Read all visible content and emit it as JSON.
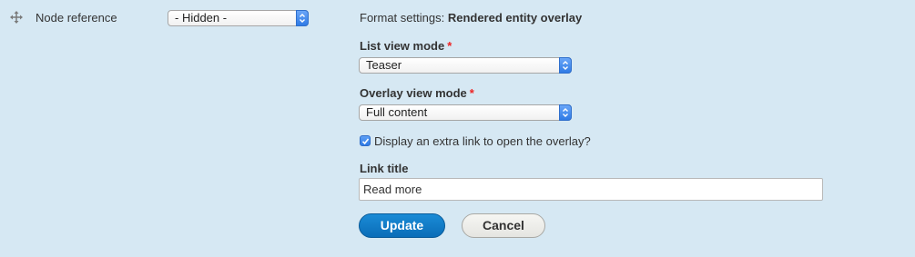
{
  "row": {
    "field_label": "Node reference",
    "label_display_select": "- Hidden -"
  },
  "format_settings": {
    "prefix": "Format settings:",
    "formatter_name": "Rendered entity overlay",
    "list_view_mode": {
      "label": "List view mode",
      "required_marker": "*",
      "value": "Teaser"
    },
    "overlay_view_mode": {
      "label": "Overlay view mode",
      "required_marker": "*",
      "value": "Full content"
    },
    "extra_link_checkbox": {
      "label": "Display an extra link to open the overlay?",
      "checked": true
    },
    "link_title": {
      "label": "Link title",
      "value": "Read more"
    }
  },
  "buttons": {
    "update": "Update",
    "cancel": "Cancel"
  },
  "colors": {
    "background": "#d6e8f3",
    "required": "#e22222",
    "primary_button": "#0a6db8",
    "select_arrow": "#2f7ae5"
  },
  "icons": {
    "drag_handle": "move-arrows-icon",
    "select_arrow": "updown-chevron-icon",
    "checkbox_mark": "checkmark-icon"
  }
}
